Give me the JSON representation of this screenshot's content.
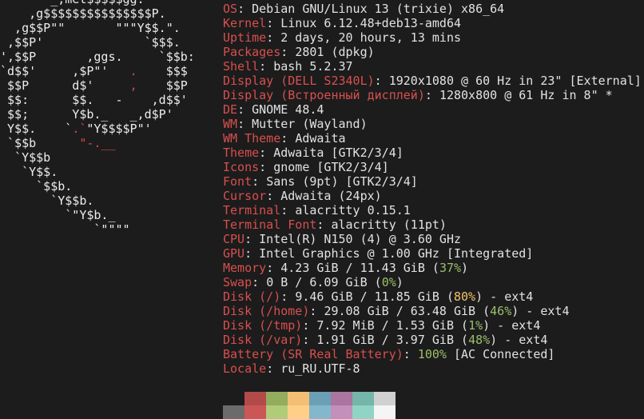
{
  "logo": {
    "lines": [
      "       _,met$$$$$gg.",
      "    ,g$$$$$$$$$$$$$$$P.",
      "  ,g$$P\"\"       \"\"\"Y$$.\".",
      " ,$$P'              `$$$.",
      "',$$P       ,ggs.     `$$b:",
      "`d$$'     ,$P\"'   .    $$$",
      " $$P      d$'     ,    $$P",
      " $$:      $$.   -    ,d$$'",
      " $$;      Y$b._   _,d$P'",
      " Y$$.    `.`\"Y$$$$P\"'",
      " `$$b      \"-.__",
      "  `Y$$b",
      "   `Y$$.",
      "     `$$b.",
      "       `Y$$b.",
      "         `\"Y$b._",
      "             `\"\"\"\""
    ]
  },
  "info": {
    "lines": [
      {
        "key": "OS",
        "value": "Debian GNU/Linux 13 (trixie) x86_64"
      },
      {
        "key": "Kernel",
        "value": "Linux 6.12.48+deb13-amd64"
      },
      {
        "key": "Uptime",
        "value": "2 days, 20 hours, 13 mins"
      },
      {
        "key": "Packages",
        "value": "2801 (dpkg)"
      },
      {
        "key": "Shell",
        "value": "bash 5.2.37"
      },
      {
        "key": "Display (DELL S2340L)",
        "value": "1920x1080 @ 60 Hz in 23\" [External]"
      },
      {
        "key": "Display (Встроенный дисплей)",
        "value": "1280x800 @ 61 Hz in 8\" *"
      },
      {
        "key": "DE",
        "value": "GNOME 48.4"
      },
      {
        "key": "WM",
        "value": "Mutter (Wayland)"
      },
      {
        "key": "WM Theme",
        "value": "Adwaita"
      },
      {
        "key": "Theme",
        "value": "Adwaita [GTK2/3/4]"
      },
      {
        "key": "Icons",
        "value": "gnome [GTK2/3/4]"
      },
      {
        "key": "Font",
        "value": "Sans (9pt) [GTK2/3/4]"
      },
      {
        "key": "Cursor",
        "value": "Adwaita (24px)"
      },
      {
        "key": "Terminal",
        "value": "alacritty 0.15.1"
      },
      {
        "key": "Terminal Font",
        "value": "alacritty (11pt)"
      },
      {
        "key": "CPU",
        "value": "Intel(R) N150 (4) @ 3.60 GHz"
      },
      {
        "key": "GPU",
        "value": "Intel Graphics @ 1.00 GHz [Integrated]"
      },
      {
        "key": "Memory",
        "pre": "4.23 GiB / 11.43 GiB (",
        "pct": "37%",
        "pct_color": "#9cbf6a",
        "post": ")"
      },
      {
        "key": "Swap",
        "pre": "0 B / 6.09 GiB (",
        "pct": "0%",
        "pct_color": "#9cbf6a",
        "post": ")"
      },
      {
        "key": "Disk (/)",
        "pre": "9.46 GiB / 11.85 GiB (",
        "pct": "80%",
        "pct_color": "#f2c36a",
        "post": ") - ext4"
      },
      {
        "key": "Disk (/home)",
        "pre": "29.08 GiB / 63.48 GiB (",
        "pct": "46%",
        "pct_color": "#9cbf6a",
        "post": ") - ext4"
      },
      {
        "key": "Disk (/tmp)",
        "pre": "7.92 MiB / 1.53 GiB (",
        "pct": "1%",
        "pct_color": "#9cbf6a",
        "post": ") - ext4"
      },
      {
        "key": "Disk (/var)",
        "pre": "1.91 GiB / 3.97 GiB (",
        "pct": "48%",
        "pct_color": "#9cbf6a",
        "post": ") - ext4"
      },
      {
        "key": "Battery (SR Real Battery)",
        "pre": "",
        "pct": "100%",
        "pct_color": "#9cbf6a",
        "post": " [AC Connected]"
      },
      {
        "key": "Locale",
        "value": "ru_RU.UTF-8"
      }
    ]
  },
  "colors": {
    "key": "#d84f4f",
    "value": "#e2e2e2",
    "background": "#1c1c1c"
  },
  "palette": {
    "normal": [
      "#1c1c1c",
      "#b24a4a",
      "#94ac5e",
      "#f4bf75",
      "#6a9fb5",
      "#aa759f",
      "#75b5aa",
      "#d0d0d0"
    ],
    "bright": [
      "#6b6b6b",
      "#cc5555",
      "#b1cc77",
      "#ffcf88",
      "#82b7cc",
      "#c38fbb",
      "#8fd4c5",
      "#f5f5f5"
    ]
  }
}
